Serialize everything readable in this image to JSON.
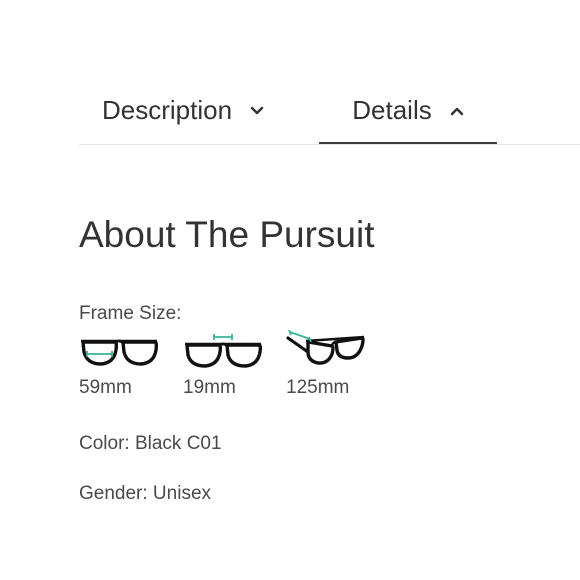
{
  "tabs": [
    {
      "label": "Description",
      "state": "collapsed"
    },
    {
      "label": "Details",
      "state": "expanded"
    }
  ],
  "details": {
    "title": "About The Pursuit",
    "frame_size_label": "Frame Size:",
    "measurements": [
      {
        "icon": "lens-width-icon",
        "value": "59mm"
      },
      {
        "icon": "bridge-width-icon",
        "value": "19mm"
      },
      {
        "icon": "temple-length-icon",
        "value": "125mm"
      }
    ],
    "color_line": "Color: Black C01",
    "gender_line": "Gender: Unisex"
  },
  "colors": {
    "text": "#333333",
    "measure_indicator": "#3bb39a",
    "frame": "#111111"
  }
}
